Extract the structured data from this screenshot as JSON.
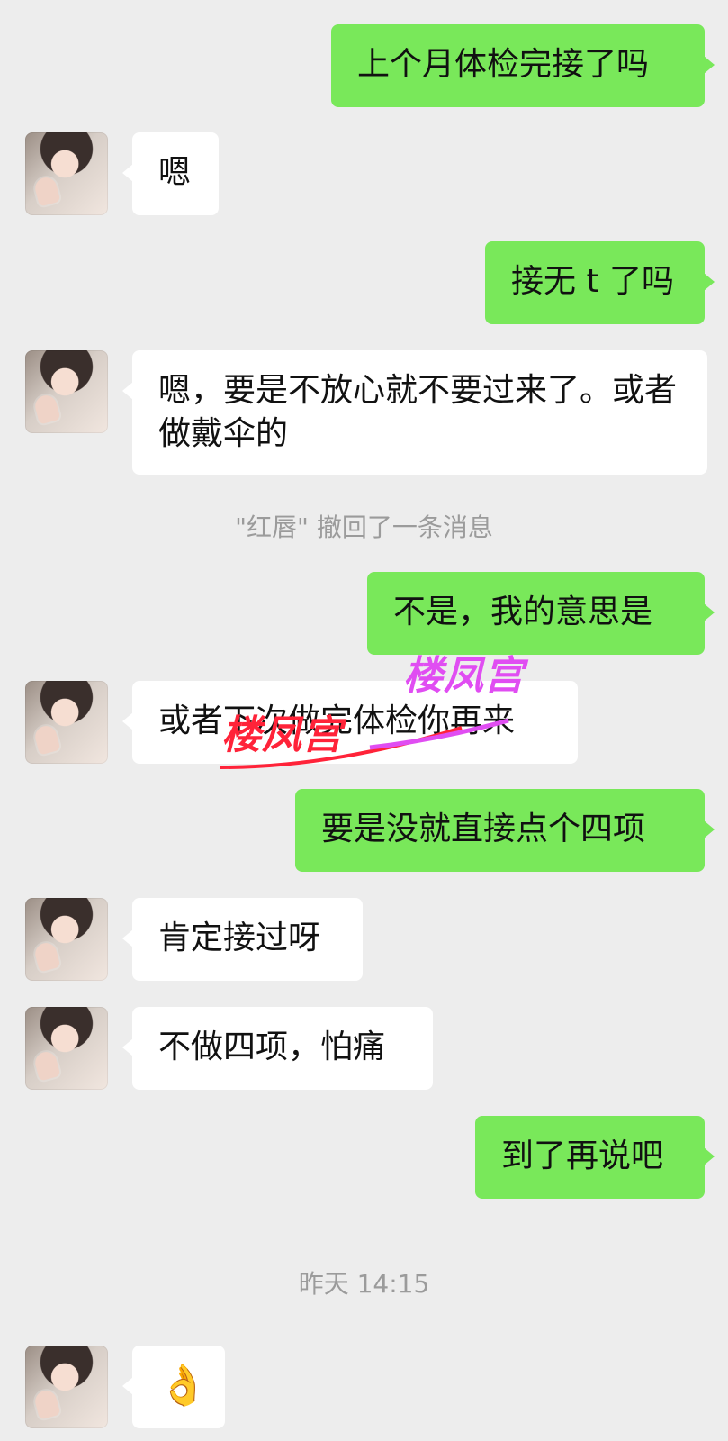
{
  "messages": [
    {
      "side": "me",
      "text": "上个月体检完接了吗"
    },
    {
      "side": "other",
      "text": "嗯"
    },
    {
      "side": "me",
      "text": "接无 t 了吗"
    },
    {
      "side": "other",
      "text": "嗯，要是不放心就不要过来了。或者做戴伞的"
    },
    {
      "system": "\"红唇\" 撤回了一条消息"
    },
    {
      "side": "me",
      "text": "不是，我的意思是"
    },
    {
      "side": "other",
      "text": "或者下次做完体检你再来"
    },
    {
      "side": "me",
      "text": "要是没就直接点个四项"
    },
    {
      "side": "other",
      "text": "肯定接过呀"
    },
    {
      "side": "other",
      "text": "不做四项，怕痛"
    },
    {
      "side": "me",
      "text": "到了再说吧"
    },
    {
      "timestamp": "昨天 14:15"
    },
    {
      "side": "other",
      "text": "👌"
    }
  ],
  "watermark": {
    "text": "楼凤宫"
  }
}
